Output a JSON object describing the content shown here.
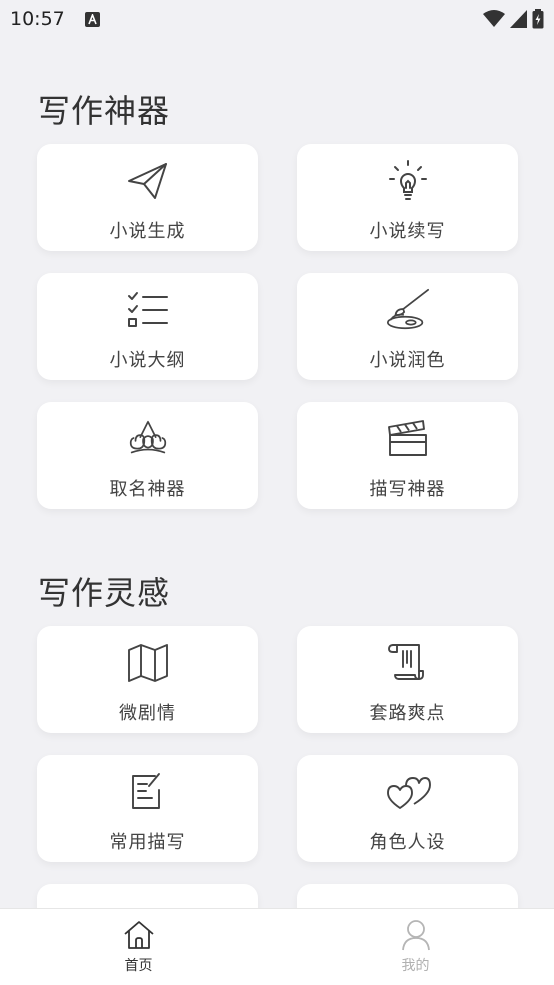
{
  "status": {
    "time": "10:57"
  },
  "sections": [
    {
      "title": "写作神器",
      "items": [
        {
          "label": "小说生成",
          "icon": "paper-plane-icon"
        },
        {
          "label": "小说续写",
          "icon": "lightbulb-icon"
        },
        {
          "label": "小说大纲",
          "icon": "checklist-icon"
        },
        {
          "label": "小说润色",
          "icon": "brush-palette-icon"
        },
        {
          "label": "取名神器",
          "icon": "crown-icon"
        },
        {
          "label": "描写神器",
          "icon": "clapperboard-icon"
        }
      ]
    },
    {
      "title": "写作灵感",
      "items": [
        {
          "label": "微剧情",
          "icon": "map-icon"
        },
        {
          "label": "套路爽点",
          "icon": "scroll-icon"
        },
        {
          "label": "常用描写",
          "icon": "edit-note-icon"
        },
        {
          "label": "角色人设",
          "icon": "double-heart-icon"
        }
      ]
    }
  ],
  "nav": {
    "home_label": "首页",
    "mine_label": "我的"
  }
}
